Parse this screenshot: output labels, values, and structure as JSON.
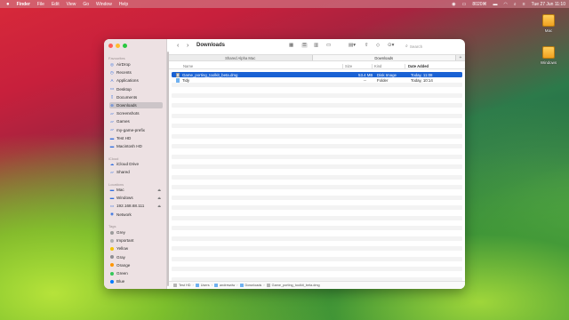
{
  "menubar": {
    "apple_icon": "",
    "items": [
      "Finder",
      "File",
      "Edit",
      "View",
      "Go",
      "Window",
      "Help"
    ],
    "status": {
      "keyboard": "8020⌘",
      "datetime": "Tue 27 Jun  11:10",
      "icons": [
        "record-icon",
        "screen-icon",
        "battery-icon",
        "wifi-icon",
        "search-icon",
        "control-center-icon"
      ]
    }
  },
  "desktop": {
    "icons": [
      {
        "label": "Mac"
      },
      {
        "label": "Windows"
      }
    ]
  },
  "window": {
    "title": "Downloads",
    "nav": {
      "back": "‹",
      "forward": "›"
    },
    "search_placeholder": "Search",
    "tabs": [
      "Shared Alpha Mac",
      "Downloads"
    ],
    "tab_add": "+",
    "columns": {
      "name": "Name",
      "size": "Size",
      "kind": "Kind",
      "date": "Date Added"
    },
    "files": [
      {
        "name": "Game_porting_toolkit_beta.dmg",
        "size": "53.4 MB",
        "kind": "Disk Image",
        "date": "Today, 11:08",
        "icon": "disk-image-icon",
        "selected": true
      },
      {
        "name": "Tidy",
        "size": "--",
        "kind": "Folder",
        "date": "Today, 10:14",
        "icon": "folder-icon",
        "selected": false
      }
    ],
    "pathbar": [
      "Test HD",
      "Users",
      "andrewdw",
      "Downloads",
      "Game_porting_toolkit_beta.dmg"
    ]
  },
  "sidebar": {
    "favourites_label": "Favourites",
    "favourites": [
      {
        "label": "AirDrop",
        "icon": "airdrop-icon"
      },
      {
        "label": "Recents",
        "icon": "clock-icon"
      },
      {
        "label": "Applications",
        "icon": "applications-icon"
      },
      {
        "label": "Desktop",
        "icon": "desktop-icon"
      },
      {
        "label": "Documents",
        "icon": "document-icon"
      },
      {
        "label": "Downloads",
        "icon": "download-icon",
        "selected": true
      },
      {
        "label": "Screenshots",
        "icon": "folder-icon"
      },
      {
        "label": "Games",
        "icon": "folder-icon"
      },
      {
        "label": "my-game-prefix",
        "icon": "folder-icon"
      },
      {
        "label": "Test HD",
        "icon": "drive-icon"
      },
      {
        "label": "Macintosh HD",
        "icon": "drive-icon"
      }
    ],
    "icloud_label": "iCloud",
    "icloud": [
      {
        "label": "iCloud Drive",
        "icon": "cloud-icon"
      },
      {
        "label": "Shared",
        "icon": "shared-folder-icon"
      }
    ],
    "locations_label": "Locations",
    "locations": [
      {
        "label": "Mac",
        "icon": "drive-icon"
      },
      {
        "label": "Windows",
        "icon": "drive-icon"
      },
      {
        "label": "192.168.68.111",
        "icon": "display-icon"
      },
      {
        "label": "Network",
        "icon": "network-icon"
      }
    ],
    "tags_label": "Tags",
    "tags": [
      {
        "label": "Grey",
        "color": "#9b9b9b"
      },
      {
        "label": "Important",
        "color": "#b0b0b0"
      },
      {
        "label": "Yellow",
        "color": "#f5c400"
      },
      {
        "label": "Gray",
        "color": "#8e8e93"
      },
      {
        "label": "Orange",
        "color": "#ff9500"
      },
      {
        "label": "Green",
        "color": "#34c759"
      },
      {
        "label": "Blue",
        "color": "#007aff"
      }
    ]
  }
}
